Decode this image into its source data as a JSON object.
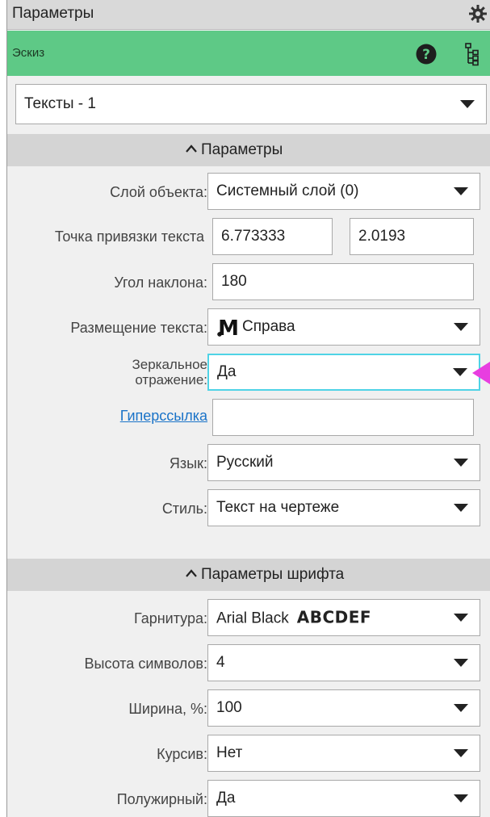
{
  "window": {
    "title": "Параметры"
  },
  "context": {
    "label": "Эскиз"
  },
  "selector": {
    "value": "Тексты - 1"
  },
  "section1": {
    "title": "Параметры",
    "rows": {
      "layer": {
        "label": "Слой объекта:",
        "value": "Системный слой (0)"
      },
      "anchor": {
        "label": "Точка привязки текста",
        "x": "6.773333",
        "y": "2.0193"
      },
      "angle": {
        "label": "Угол наклона:",
        "value": "180"
      },
      "placement": {
        "label": "Размещение текста:",
        "value": "Справа"
      },
      "mirror": {
        "label_line1": "Зеркальное",
        "label_line2": "отражение:",
        "value": "Да"
      },
      "hyperlink": {
        "label": "Гиперссылка",
        "value": ""
      },
      "language": {
        "label": "Язык:",
        "value": "Русский"
      },
      "style": {
        "label": "Стиль:",
        "value": "Текст на чертеже"
      }
    }
  },
  "section2": {
    "title": "Параметры шрифта",
    "rows": {
      "font": {
        "label": "Гарнитура:",
        "value": "Arial Black",
        "preview": "ABCDEF"
      },
      "height": {
        "label": "Высота символов:",
        "value": "4"
      },
      "width": {
        "label": "Ширина, %:",
        "value": "100"
      },
      "italic": {
        "label": "Курсив:",
        "value": "Нет"
      },
      "bold": {
        "label": "Полужирный:",
        "value": "Да"
      }
    }
  },
  "colors": {
    "context_bar": "#5ec986",
    "focus_border": "#4fd3e6",
    "pointer": "#e83ee0",
    "link": "#1a73c8"
  },
  "icons": [
    "gear-icon",
    "help-icon",
    "tree-icon",
    "caret-up-icon",
    "chevron-down-icon",
    "text-placement-icon"
  ]
}
